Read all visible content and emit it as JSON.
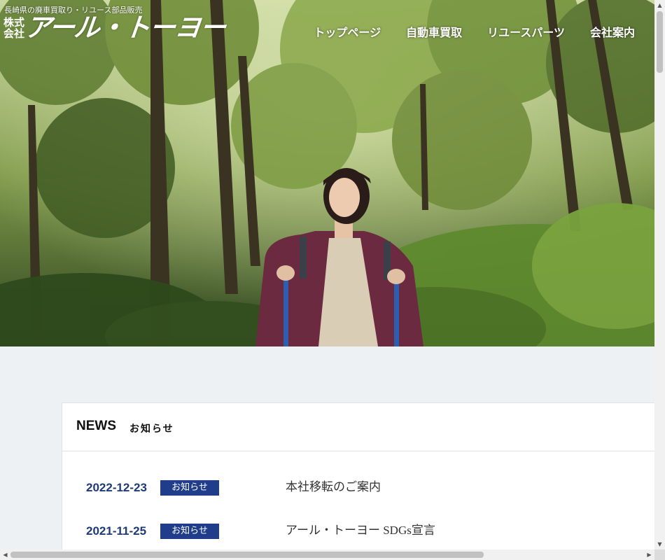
{
  "header": {
    "tagline": "長崎県の廃車買取り・リユース部品販売",
    "logo_prefix": "株式会社",
    "logo_name": "アール・トーヨー"
  },
  "nav": {
    "items": [
      {
        "label": "トップページ"
      },
      {
        "label": "自動車買取"
      },
      {
        "label": "リユースパーツ"
      },
      {
        "label": "会社案内"
      }
    ]
  },
  "news": {
    "title": "NEWS",
    "subtitle": "お知らせ",
    "items": [
      {
        "date": "2022-12-23",
        "category": "お知らせ",
        "text": "本社移転のご案内"
      },
      {
        "date": "2021-11-25",
        "category": "お知らせ",
        "text": "アール・トーヨー SDGs宣言"
      }
    ]
  },
  "colors": {
    "accent": "#1f3d8a",
    "date_text": "#1e3a78",
    "page_bg": "#eef1f4"
  },
  "scrollbars": {
    "up_icon": "arrow-up-icon",
    "down_icon": "arrow-down-icon",
    "left_icon": "arrow-left-icon",
    "right_icon": "arrow-right-icon"
  }
}
